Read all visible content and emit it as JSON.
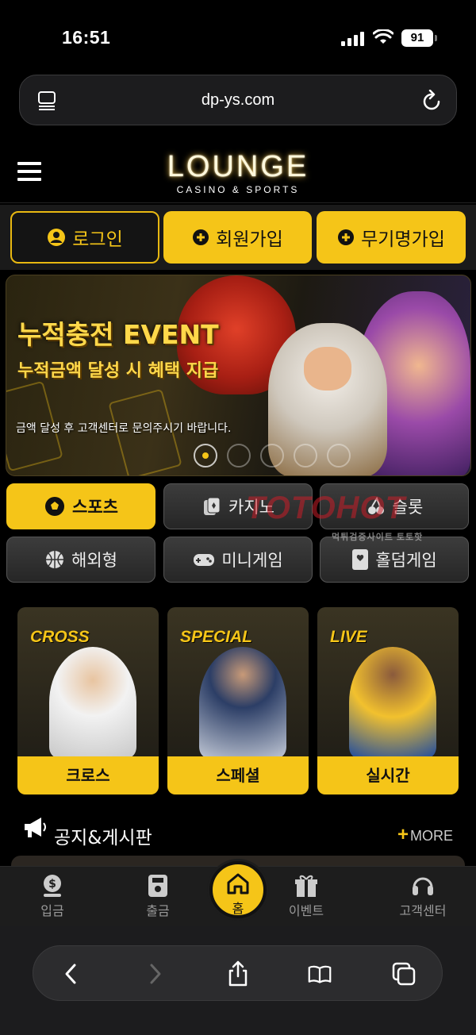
{
  "status_bar": {
    "time": "16:51",
    "battery": "91"
  },
  "browser": {
    "url": "dp-ys.com"
  },
  "header": {
    "logo_main": "LOUNGE",
    "logo_sub": "CASINO & SPORTS"
  },
  "auth": {
    "login": "로그인",
    "signup": "회원가입",
    "anon_signup": "무기명가입"
  },
  "banner": {
    "title": "누적충전 EVENT",
    "subtitle": "누적금액 달성 시 혜택 지급",
    "note": "금액 달성 후 고객센터로 문의주시기 바랍니다."
  },
  "categories": [
    {
      "label": "스포츠",
      "icon": "soccer-ball-icon",
      "active": true
    },
    {
      "label": "카지노",
      "icon": "cards-icon",
      "active": false
    },
    {
      "label": "슬롯",
      "icon": "cherry-icon",
      "active": false
    },
    {
      "label": "해외형",
      "icon": "basketball-icon",
      "active": false
    },
    {
      "label": "미니게임",
      "icon": "gamepad-icon",
      "active": false
    },
    {
      "label": "홀덤게임",
      "icon": "playing-card-icon",
      "active": false
    }
  ],
  "watermark": {
    "text": "TOTOHOT",
    "sub": "먹튀검증사이트 토토핫"
  },
  "game_cards": [
    {
      "tag": "CROSS",
      "label": "크로스"
    },
    {
      "tag": "SPECIAL",
      "label": "스페셜"
    },
    {
      "tag": "LIVE",
      "label": "실시간"
    }
  ],
  "notice": {
    "title": "공지&게시판",
    "more": "MORE"
  },
  "bottom_nav": {
    "deposit": "입금",
    "withdraw": "출금",
    "home": "홈",
    "event": "이벤트",
    "support": "고객센터"
  },
  "colors": {
    "accent": "#f5c518",
    "background": "#000000",
    "panel": "#1d1d1d"
  }
}
